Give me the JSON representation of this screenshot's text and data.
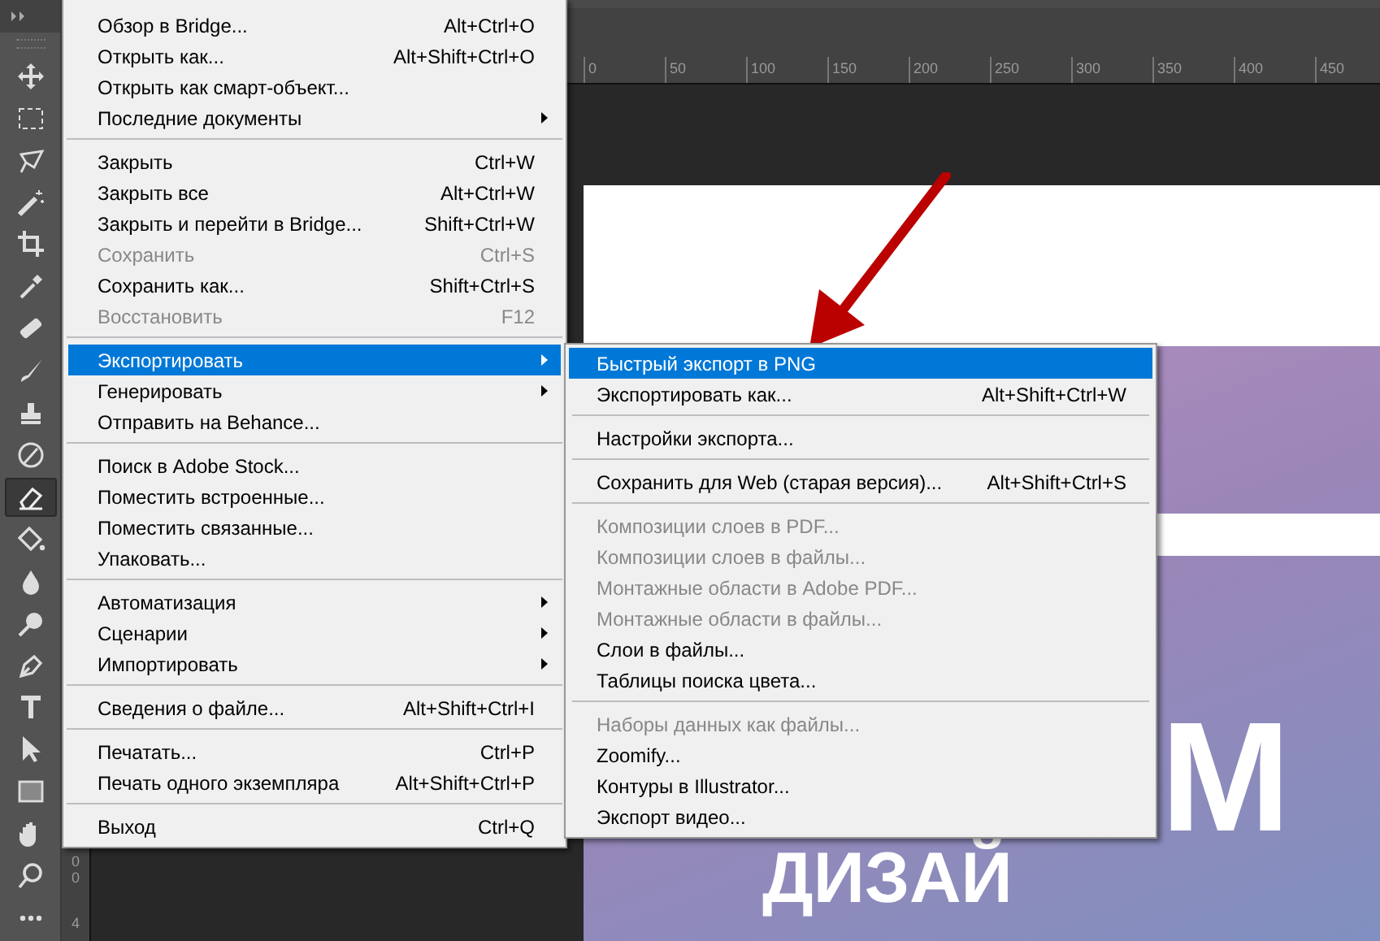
{
  "tools": [
    {
      "kind": "move",
      "selected": false
    },
    {
      "kind": "marquee",
      "selected": false
    },
    {
      "kind": "lasso",
      "selected": false
    },
    {
      "kind": "wand",
      "selected": false
    },
    {
      "kind": "crop",
      "selected": false
    },
    {
      "kind": "eyedropper",
      "selected": false
    },
    {
      "kind": "healing",
      "selected": false
    },
    {
      "kind": "brush",
      "selected": false
    },
    {
      "kind": "stamp",
      "selected": false
    },
    {
      "kind": "history",
      "selected": false
    },
    {
      "kind": "eraser",
      "selected": true
    },
    {
      "kind": "bucket",
      "selected": false
    },
    {
      "kind": "drop",
      "selected": false
    },
    {
      "kind": "dodge",
      "selected": false
    },
    {
      "kind": "pen",
      "selected": false
    },
    {
      "kind": "type",
      "selected": false
    },
    {
      "kind": "pointer",
      "selected": false
    },
    {
      "kind": "rect",
      "selected": false
    },
    {
      "kind": "hand",
      "selected": false
    },
    {
      "kind": "zoom",
      "selected": false
    },
    {
      "kind": "more",
      "selected": false
    }
  ],
  "ruler": {
    "labels": [
      "0",
      "50",
      "100",
      "150",
      "200",
      "250",
      "300",
      "350",
      "400",
      "450"
    ],
    "vertical_labels": [
      "00",
      "4"
    ]
  },
  "canvas": {
    "lines": [
      "М",
      "ДИЗАЙ"
    ]
  },
  "file_menu": {
    "items": [
      {
        "kind": "item",
        "label": "Обзор в Bridge...",
        "shortcut": "Alt+Ctrl+O",
        "disabled": false,
        "selected": false,
        "has_submenu": false
      },
      {
        "kind": "item",
        "label": "Открыть как...",
        "shortcut": "Alt+Shift+Ctrl+O",
        "disabled": false,
        "selected": false,
        "has_submenu": false
      },
      {
        "kind": "item",
        "label": "Открыть как смарт-объект...",
        "disabled": false,
        "selected": false,
        "has_submenu": false
      },
      {
        "kind": "item",
        "label": "Последние документы",
        "disabled": false,
        "selected": false,
        "has_submenu": true
      },
      {
        "kind": "separator"
      },
      {
        "kind": "item",
        "label": "Закрыть",
        "shortcut": "Ctrl+W",
        "disabled": false,
        "selected": false,
        "has_submenu": false
      },
      {
        "kind": "item",
        "label": "Закрыть все",
        "shortcut": "Alt+Ctrl+W",
        "disabled": false,
        "selected": false,
        "has_submenu": false
      },
      {
        "kind": "item",
        "label": "Закрыть и перейти в Bridge...",
        "shortcut": "Shift+Ctrl+W",
        "disabled": false,
        "selected": false,
        "has_submenu": false
      },
      {
        "kind": "item",
        "label": "Сохранить",
        "shortcut": "Ctrl+S",
        "disabled": true,
        "selected": false,
        "has_submenu": false
      },
      {
        "kind": "item",
        "label": "Сохранить как...",
        "shortcut": "Shift+Ctrl+S",
        "disabled": false,
        "selected": false,
        "has_submenu": false
      },
      {
        "kind": "item",
        "label": "Восстановить",
        "shortcut": "F12",
        "disabled": true,
        "selected": false,
        "has_submenu": false
      },
      {
        "kind": "separator"
      },
      {
        "kind": "item",
        "label": "Экспортировать",
        "disabled": false,
        "selected": true,
        "has_submenu": true
      },
      {
        "kind": "item",
        "label": "Генерировать",
        "disabled": false,
        "selected": false,
        "has_submenu": true
      },
      {
        "kind": "item",
        "label": "Отправить на Behance...",
        "disabled": false,
        "selected": false,
        "has_submenu": false
      },
      {
        "kind": "separator"
      },
      {
        "kind": "item",
        "label": "Поиск в Adobe Stock...",
        "disabled": false,
        "selected": false,
        "has_submenu": false
      },
      {
        "kind": "item",
        "label": "Поместить встроенные...",
        "disabled": false,
        "selected": false,
        "has_submenu": false
      },
      {
        "kind": "item",
        "label": "Поместить связанные...",
        "disabled": false,
        "selected": false,
        "has_submenu": false
      },
      {
        "kind": "item",
        "label": "Упаковать...",
        "disabled": false,
        "selected": false,
        "has_submenu": false
      },
      {
        "kind": "separator"
      },
      {
        "kind": "item",
        "label": "Автоматизация",
        "disabled": false,
        "selected": false,
        "has_submenu": true
      },
      {
        "kind": "item",
        "label": "Сценарии",
        "disabled": false,
        "selected": false,
        "has_submenu": true
      },
      {
        "kind": "item",
        "label": "Импортировать",
        "disabled": false,
        "selected": false,
        "has_submenu": true
      },
      {
        "kind": "separator"
      },
      {
        "kind": "item",
        "label": "Сведения о файле...",
        "shortcut": "Alt+Shift+Ctrl+I",
        "disabled": false,
        "selected": false,
        "has_submenu": false
      },
      {
        "kind": "separator"
      },
      {
        "kind": "item",
        "label": "Печатать...",
        "shortcut": "Ctrl+P",
        "disabled": false,
        "selected": false,
        "has_submenu": false
      },
      {
        "kind": "item",
        "label": "Печать одного экземпляра",
        "shortcut": "Alt+Shift+Ctrl+P",
        "disabled": false,
        "selected": false,
        "has_submenu": false
      },
      {
        "kind": "separator"
      },
      {
        "kind": "item",
        "label": "Выход",
        "shortcut": "Ctrl+Q",
        "disabled": false,
        "selected": false,
        "has_submenu": false
      }
    ]
  },
  "export_submenu": {
    "items": [
      {
        "kind": "item",
        "label": "Быстрый экспорт в PNG",
        "disabled": false,
        "selected": true
      },
      {
        "kind": "item",
        "label": "Экспортировать как...",
        "shortcut": "Alt+Shift+Ctrl+W",
        "disabled": false,
        "selected": false
      },
      {
        "kind": "separator"
      },
      {
        "kind": "item",
        "label": "Настройки экспорта...",
        "disabled": false,
        "selected": false
      },
      {
        "kind": "separator"
      },
      {
        "kind": "item",
        "label": "Сохранить для Web (старая версия)...",
        "shortcut": "Alt+Shift+Ctrl+S",
        "disabled": false,
        "selected": false
      },
      {
        "kind": "separator"
      },
      {
        "kind": "item",
        "label": "Композиции слоев в PDF...",
        "disabled": true,
        "selected": false
      },
      {
        "kind": "item",
        "label": "Композиции слоев в файлы...",
        "disabled": true,
        "selected": false
      },
      {
        "kind": "item",
        "label": "Монтажные области в Adobe PDF...",
        "disabled": true,
        "selected": false
      },
      {
        "kind": "item",
        "label": "Монтажные области в файлы...",
        "disabled": true,
        "selected": false
      },
      {
        "kind": "item",
        "label": "Слои в файлы...",
        "disabled": false,
        "selected": false
      },
      {
        "kind": "item",
        "label": "Таблицы поиска цвета...",
        "disabled": false,
        "selected": false
      },
      {
        "kind": "separator"
      },
      {
        "kind": "item",
        "label": "Наборы данных как файлы...",
        "disabled": true,
        "selected": false
      },
      {
        "kind": "item",
        "label": "Zoomify...",
        "disabled": false,
        "selected": false
      },
      {
        "kind": "item",
        "label": "Контуры в Illustrator...",
        "disabled": false,
        "selected": false
      },
      {
        "kind": "item",
        "label": "Экспорт видео...",
        "disabled": false,
        "selected": false
      }
    ]
  }
}
